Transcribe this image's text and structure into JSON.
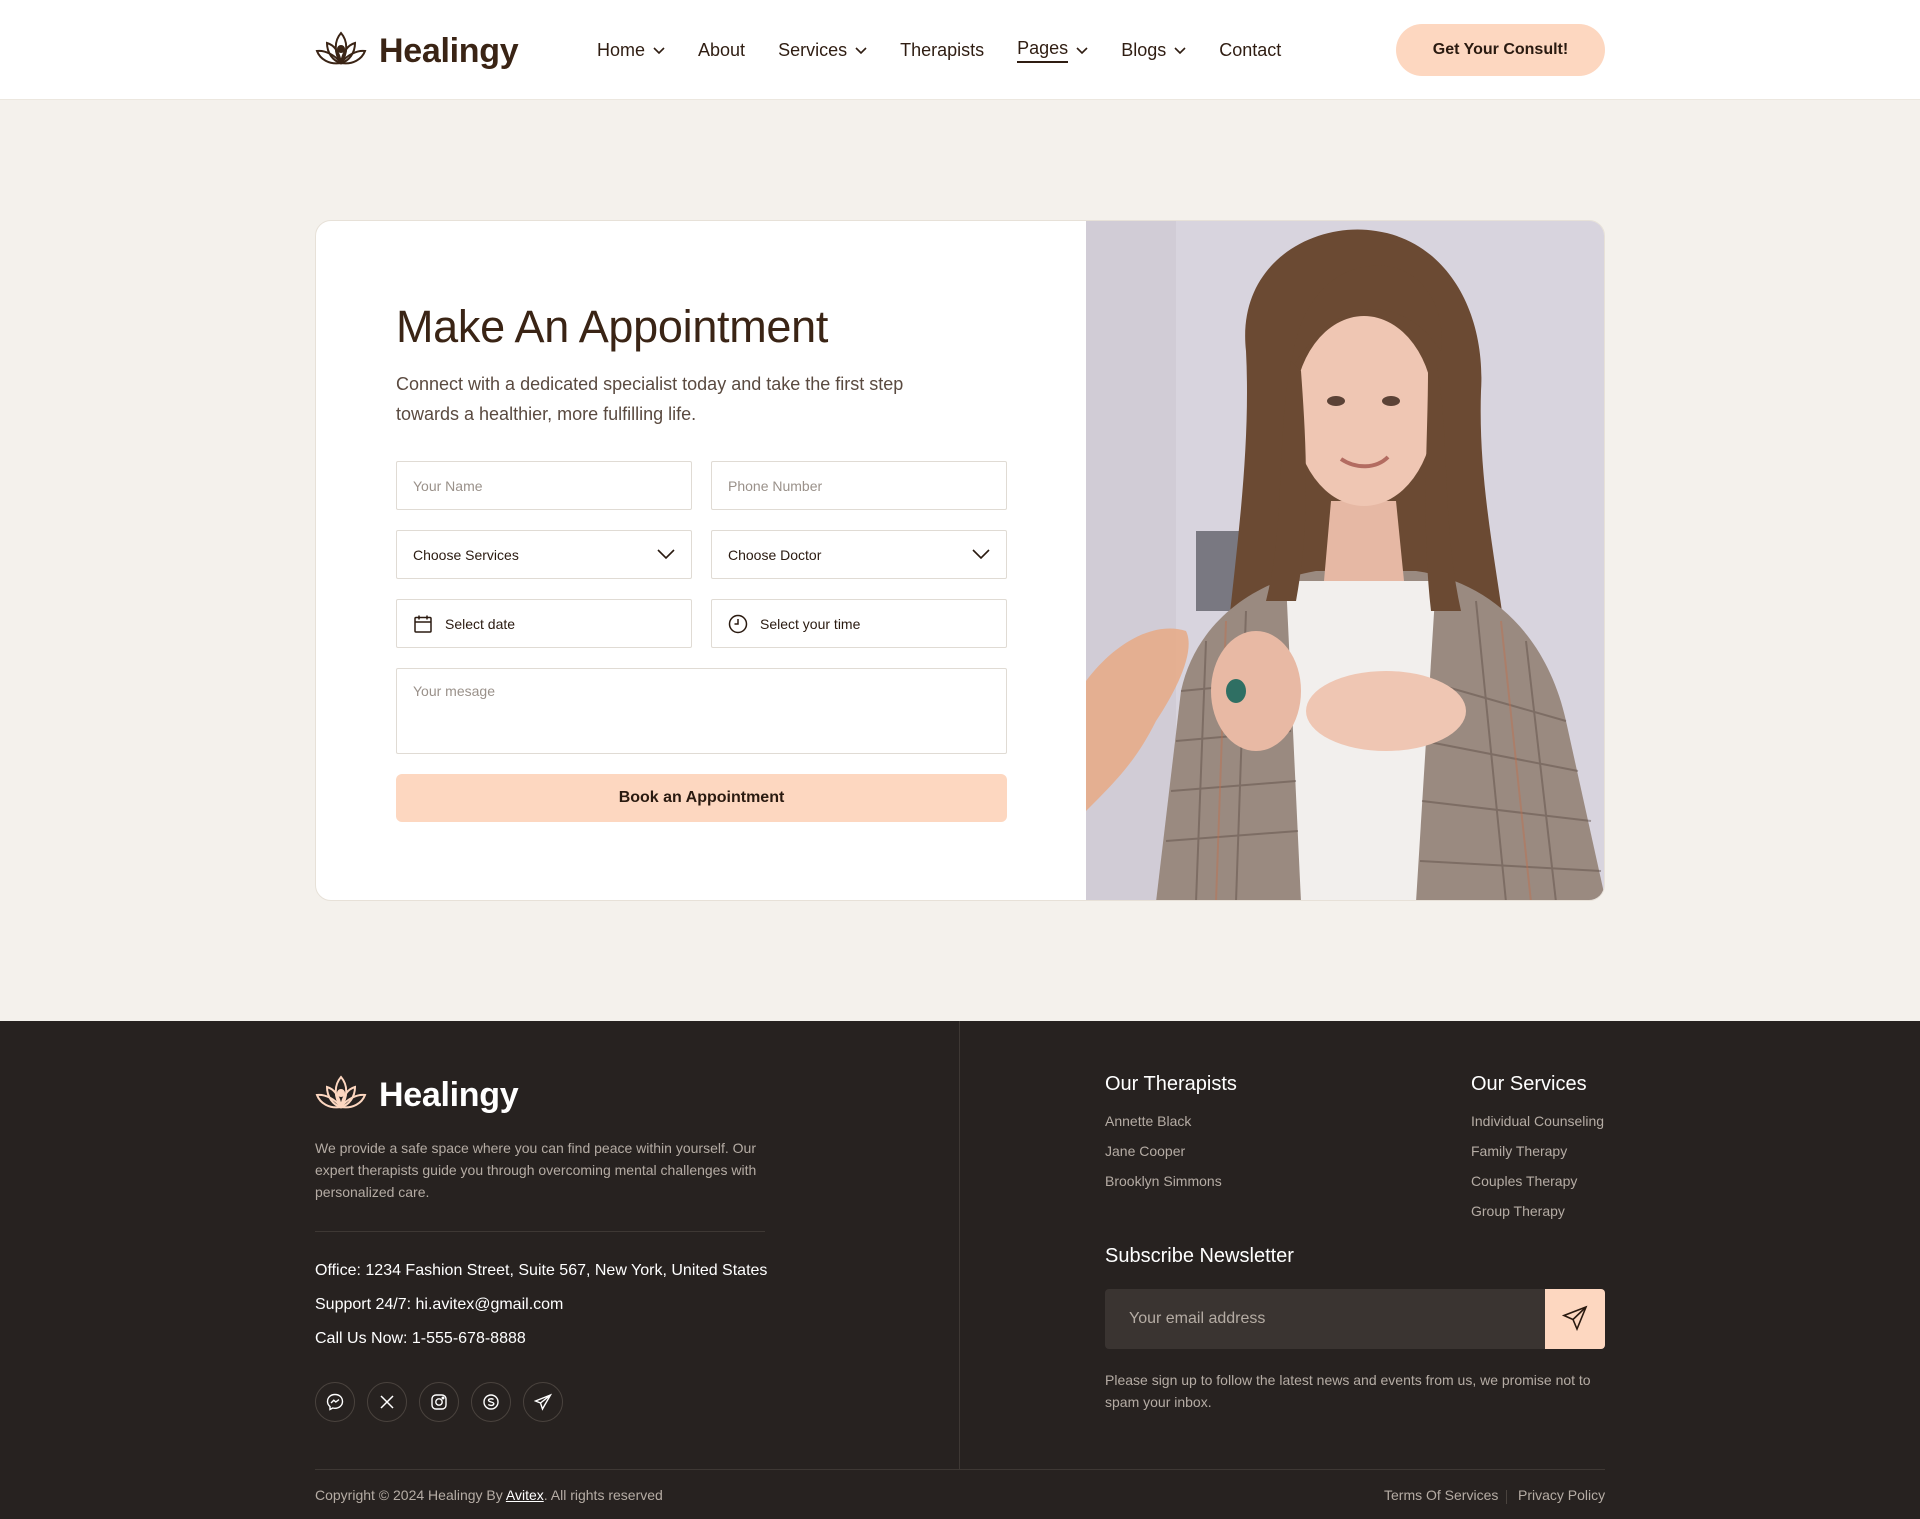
{
  "brand": {
    "name": "Healingy",
    "accent": "#fdd7c0",
    "dark": "#272220",
    "text": "#3a2415"
  },
  "nav": {
    "items": [
      {
        "label": "Home",
        "dropdown": true
      },
      {
        "label": "About",
        "dropdown": false
      },
      {
        "label": "Services",
        "dropdown": true
      },
      {
        "label": "Therapists",
        "dropdown": false
      },
      {
        "label": "Pages",
        "dropdown": true,
        "active": true
      },
      {
        "label": "Blogs",
        "dropdown": true
      },
      {
        "label": "Contact",
        "dropdown": false
      }
    ],
    "cta": "Get Your Consult!"
  },
  "appointment": {
    "title": "Make An Appointment",
    "subtitle": "Connect with a dedicated specialist today and take the first step towards a healthier, more fulfilling life.",
    "name_placeholder": "Your Name",
    "phone_placeholder": "Phone Number",
    "service_select": "Choose Services",
    "doctor_select": "Choose Doctor",
    "date_label": "Select date",
    "time_label": "Select your time",
    "message_placeholder": "Your mesage",
    "submit": "Book an Appointment"
  },
  "footer": {
    "brand": "Healingy",
    "description": "We provide a safe space where you can find peace within yourself. Our expert therapists guide you through overcoming mental challenges with personalized care.",
    "office": "Office: 1234 Fashion Street, Suite 567, New York, United States",
    "support": "Support 24/7: hi.avitex@gmail.com",
    "phone": "Call Us Now: 1-555-678-8888",
    "socials": [
      "messenger-icon",
      "x-icon",
      "instagram-icon",
      "skype-icon",
      "telegram-icon"
    ],
    "therapists": {
      "title": "Our Therapists",
      "items": [
        "Annette Black",
        "Jane Cooper",
        "Brooklyn Simmons"
      ]
    },
    "services": {
      "title": "Our Services",
      "items": [
        "Individual Counseling",
        "Family Therapy",
        "Couples Therapy",
        "Group Therapy"
      ]
    },
    "newsletter": {
      "title": "Subscribe Newsletter",
      "placeholder": "Your email address",
      "note": "Please sign up to follow the latest news and events from us, we promise not to spam your inbox."
    },
    "copyright_prefix": "Copyright © 2024 Healingy By ",
    "copyright_link": "Avitex",
    "copyright_suffix": ". All rights reserved",
    "terms": "Terms Of Services",
    "privacy": "Privacy Policy"
  }
}
